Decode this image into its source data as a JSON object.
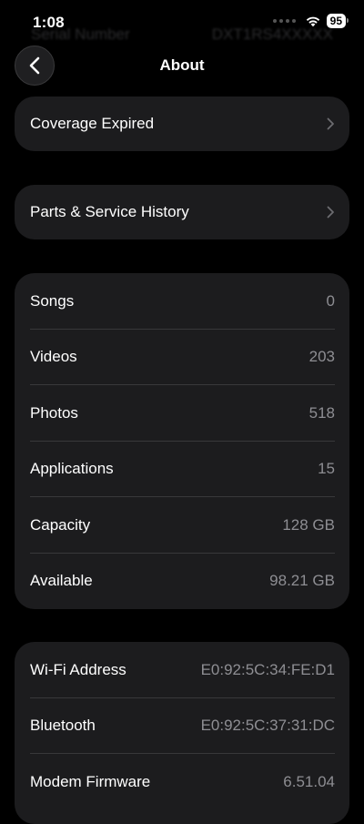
{
  "status_bar": {
    "time": "1:08",
    "battery": "95",
    "icons": [
      "wifi-icon",
      "battery-icon"
    ]
  },
  "background_ghost": {
    "label": "Serial Number",
    "value": "DXT1RS4XXXXX"
  },
  "nav": {
    "title": "About",
    "back_icon": "chevron-left-icon"
  },
  "links": [
    {
      "label": "Coverage Expired",
      "icon": "chevron-right-icon"
    },
    {
      "label": "Parts & Service History",
      "icon": "chevron-right-icon"
    }
  ],
  "media_info": [
    {
      "label": "Songs",
      "value": "0"
    },
    {
      "label": "Videos",
      "value": "203"
    },
    {
      "label": "Photos",
      "value": "518"
    },
    {
      "label": "Applications",
      "value": "15"
    },
    {
      "label": "Capacity",
      "value": "128 GB"
    },
    {
      "label": "Available",
      "value": "98.21 GB"
    }
  ],
  "network_info": [
    {
      "label": "Wi-Fi Address",
      "value": "E0:92:5C:34:FE:D1"
    },
    {
      "label": "Bluetooth",
      "value": "E0:92:5C:37:31:DC"
    },
    {
      "label": "Modem Firmware",
      "value": "6.51.04"
    }
  ],
  "colors": {
    "background": "#000000",
    "card": "#1c1c1e",
    "secondary_text": "#8e8e93",
    "divider": "#38383a"
  }
}
